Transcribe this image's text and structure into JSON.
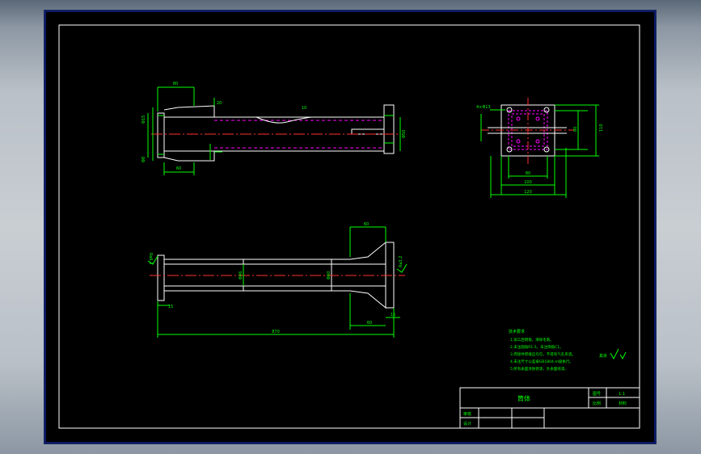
{
  "colors": {
    "background": "#000000",
    "frame": "#ffffff",
    "outline": "#ffffff",
    "dimension": "#00ff00",
    "centerline": "#ff3030",
    "hidden": "#ff00ff",
    "text_annotation": "#00ff00",
    "viewport": "#b9c0c7"
  },
  "drawing": {
    "title": "筒体",
    "title_block": {
      "cell_a1": "图号",
      "cell_a2": "比例",
      "cell_b1": "1:1",
      "cell_b2": "材料",
      "cell_c1": "审核",
      "cell_c2": "设计"
    },
    "tech_requirements": {
      "heading": "技术要求",
      "items": [
        "1.加工后倒角，清除毛刺。",
        "2.未注圆角R1.5，未注倒角C1。",
        "3.焊接件焊缝应均匀，不得有气孔夹渣。",
        "4.未注尺寸公差按GB1804-m级执行。",
        "5.所有表面涂防锈漆，外表面喷漆。"
      ]
    },
    "roughness_note": "其余",
    "dimensions": {
      "top_width": "80",
      "top_gap": "20",
      "left_vert_1": "Φ15",
      "left_vert_2": "Φ8",
      "bottom_a": "60",
      "right_dia": "Φ50",
      "mid_small": "10",
      "side_label": "4×Φ13",
      "side_w_inner": "80",
      "side_w_mid": "100",
      "side_w_outer": "120",
      "side_h_inner": "80",
      "side_h_outer": "110",
      "bottom_overall": "870",
      "bottom_right_a": "60",
      "bottom_right_b": "15",
      "bottom_left_small": "15",
      "bottom_top_dim": "60",
      "bottom_inner_a": "Φ46",
      "bottom_inner_b": "Φ60",
      "bottom_left_label": "Ra6.3",
      "bottom_right_label": "Ra3.2"
    }
  }
}
